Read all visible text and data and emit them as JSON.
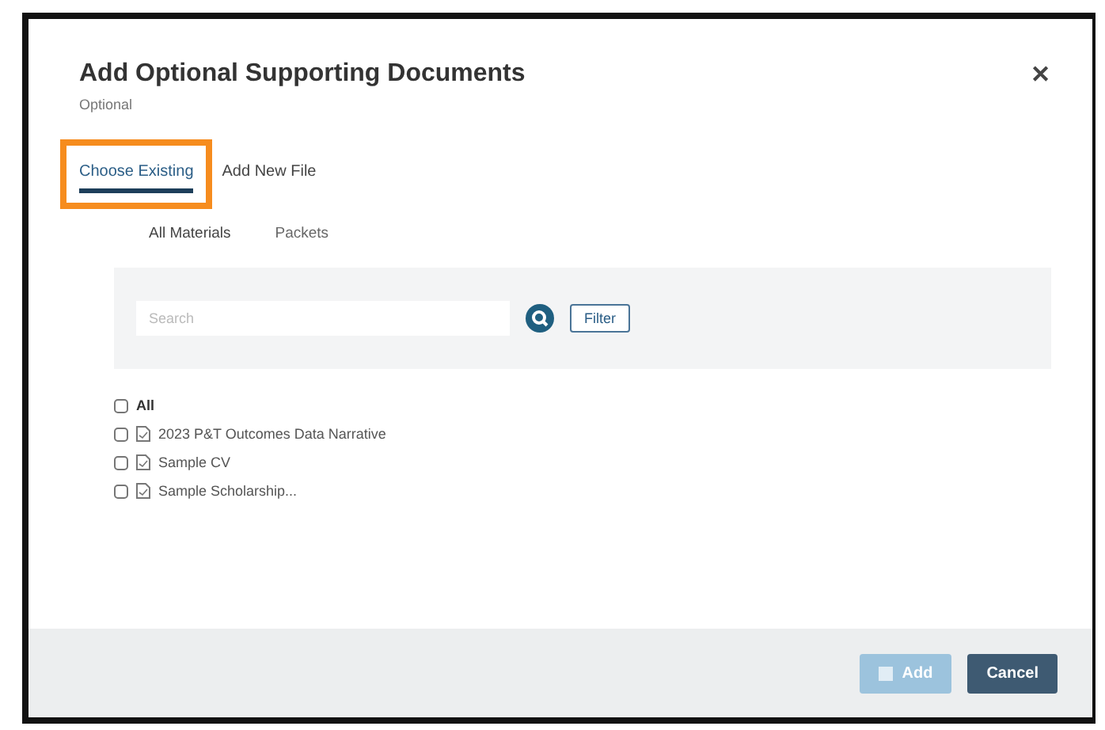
{
  "dialog": {
    "title": "Add Optional Supporting Documents",
    "subtitle": "Optional",
    "close": "✕"
  },
  "tabs": [
    {
      "label": "Choose Existing",
      "selected": true,
      "highlighted": true
    },
    {
      "label": "Add New File",
      "selected": false,
      "highlighted": false
    }
  ],
  "subtabs": [
    {
      "label": "All Materials",
      "selected": true
    },
    {
      "label": "Packets",
      "selected": false
    }
  ],
  "search": {
    "placeholder": "Search",
    "filter_button": "Filter"
  },
  "items": [
    {
      "label": "All",
      "kind": "all",
      "checked": false
    },
    {
      "label": "2023 P&T Outcomes Data Narrative",
      "kind": "file",
      "checked": false
    },
    {
      "label": "Sample CV",
      "kind": "file",
      "checked": false
    },
    {
      "label": "Sample Scholarship...",
      "kind": "file",
      "checked": false
    }
  ],
  "buttons": [
    {
      "label": "Add",
      "kind": "primary",
      "disabled": true
    },
    {
      "label": "Cancel",
      "kind": "secondary",
      "disabled": false
    }
  ]
}
